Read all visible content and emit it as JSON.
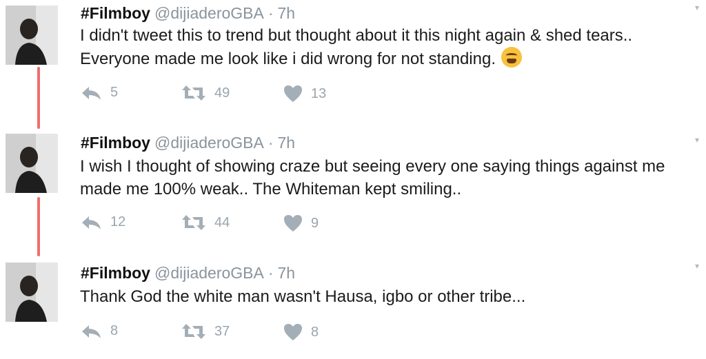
{
  "tweets": [
    {
      "name": "#Filmboy",
      "handle": "@dijiaderoGBA",
      "sep": "·",
      "time": "7h",
      "text_line1": "I didn't tweet this to trend but thought about it this night again & shed tears..",
      "text_line2": "Everyone made me look like i did wrong for not standing.",
      "emoji": "weary-face",
      "replies": "5",
      "retweets": "49",
      "likes": "13"
    },
    {
      "name": "#Filmboy",
      "handle": "@dijiaderoGBA",
      "sep": "·",
      "time": "7h",
      "text_line1": "I wish I thought of showing craze but seeing every one saying things against me",
      "text_line2": "made me 100% weak.. The Whiteman kept smiling..",
      "replies": "12",
      "retweets": "44",
      "likes": "9"
    },
    {
      "name": "#Filmboy",
      "handle": "@dijiaderoGBA",
      "sep": "·",
      "time": "7h",
      "text_line1": "Thank God the white man wasn't Hausa, igbo or other tribe...",
      "replies": "8",
      "retweets": "37",
      "likes": "8"
    }
  ],
  "colors": {
    "thread_line": "#f26d6d",
    "meta": "#8a949d",
    "icon": "#a4aeb6"
  },
  "icons": {
    "reply": "reply-icon",
    "retweet": "retweet-icon",
    "like": "heart-icon",
    "menu": "chevron-down-icon"
  }
}
